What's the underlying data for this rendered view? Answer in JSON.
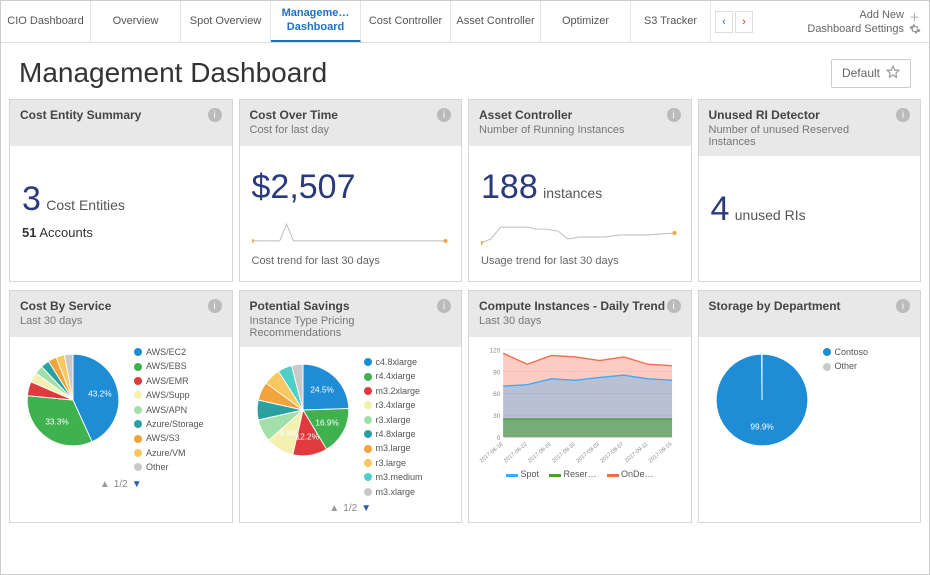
{
  "tabs": {
    "items": [
      "CIO Dashboard",
      "Overview",
      "Spot Overview",
      "Manageme… Dashboard",
      "Cost Controller",
      "Asset Controller",
      "Optimizer",
      "S3 Tracker"
    ],
    "active_index": 3
  },
  "topright": {
    "add_new": "Add New",
    "settings": "Dashboard Settings"
  },
  "header": {
    "title": "Management Dashboard",
    "default_btn": "Default"
  },
  "cards": {
    "cost_entity": {
      "title": "Cost Entity Summary",
      "big": "3",
      "big_label": "Cost Entities",
      "sub_num": "51",
      "sub_label": "Accounts"
    },
    "cost_over_time": {
      "title": "Cost Over Time",
      "subtitle": "Cost for last day",
      "big": "$2,507",
      "caption": "Cost trend for last 30 days"
    },
    "asset_controller": {
      "title": "Asset Controller",
      "subtitle": "Number of Running Instances",
      "big": "188",
      "big_label": "instances",
      "caption": "Usage trend for last 30 days"
    },
    "unused_ri": {
      "title": "Unused RI Detector",
      "subtitle": "Number of unused Reserved Instances",
      "big": "4",
      "big_label": "unused RIs"
    },
    "cost_by_service": {
      "title": "Cost By Service",
      "subtitle": "Last 30 days",
      "labels": [
        "43.2%",
        "33.3%"
      ],
      "nav": "1/2"
    },
    "potential_savings": {
      "title": "Potential Savings",
      "subtitle": "Instance Type Pricing Recommendations",
      "labels": [
        "24.5%",
        "16.9%",
        "12.2%",
        "9.9%"
      ],
      "nav": "1/2"
    },
    "compute_trend": {
      "title": "Compute Instances - Daily Trend",
      "subtitle": "Last 30 days"
    },
    "storage": {
      "title": "Storage by Department",
      "label": "99.9%"
    }
  },
  "chart_data": [
    {
      "id": "cost_trend_spark",
      "type": "line",
      "x": [
        1,
        2,
        3,
        4,
        5,
        6,
        7,
        8,
        9,
        10,
        11,
        12,
        13,
        14,
        15,
        16,
        17,
        18,
        19,
        20,
        21,
        22,
        23,
        24,
        25,
        26,
        27,
        28,
        29,
        30
      ],
      "values": [
        2300,
        2350,
        2320,
        2400,
        2380,
        5000,
        2450,
        2420,
        2400,
        2430,
        2410,
        2440,
        2460,
        2450,
        2430,
        2440,
        2420,
        2450,
        2460,
        2440,
        2450,
        2460,
        2470,
        2450,
        2440,
        2450,
        2460,
        2470,
        2480,
        2507
      ],
      "ylim": [
        2000,
        5200
      ],
      "caption": "Cost trend for last 30 days"
    },
    {
      "id": "usage_trend_spark",
      "type": "line",
      "x": [
        1,
        2,
        3,
        4,
        5,
        6,
        7,
        8,
        9,
        10,
        11,
        12,
        13,
        14,
        15,
        16,
        17,
        18,
        19,
        20,
        21,
        22,
        23,
        24,
        25,
        26,
        27,
        28,
        29,
        30
      ],
      "values": [
        140,
        150,
        200,
        205,
        210,
        205,
        195,
        200,
        198,
        190,
        195,
        192,
        190,
        165,
        170,
        168,
        172,
        170,
        175,
        172,
        174,
        176,
        175,
        174,
        176,
        178,
        176,
        180,
        182,
        188
      ],
      "ylim": [
        130,
        220
      ],
      "caption": "Usage trend for last 30 days"
    },
    {
      "id": "cost_by_service",
      "type": "pie",
      "series": [
        {
          "name": "AWS/EC2",
          "value": 43.2,
          "color": "#1f8dd6"
        },
        {
          "name": "AWS/EBS",
          "value": 33.3,
          "color": "#3fb24f"
        },
        {
          "name": "AWS/EMR",
          "value": 5.0,
          "color": "#e0393e"
        },
        {
          "name": "AWS/Supp",
          "value": 3.5,
          "color": "#f4f0b0"
        },
        {
          "name": "AWS/APN",
          "value": 3.0,
          "color": "#a3e0a8"
        },
        {
          "name": "Azure/Storage",
          "value": 3.0,
          "color": "#2aa0a0"
        },
        {
          "name": "AWS/S3",
          "value": 3.0,
          "color": "#f2a33c"
        },
        {
          "name": "Azure/VM",
          "value": 3.0,
          "color": "#f7c85f"
        },
        {
          "name": "Other",
          "value": 3.0,
          "color": "#c9c9c9"
        }
      ]
    },
    {
      "id": "potential_savings",
      "type": "pie",
      "series": [
        {
          "name": "c4.8xlarge",
          "value": 24.5,
          "color": "#1f8dd6"
        },
        {
          "name": "r4.4xlarge",
          "value": 16.9,
          "color": "#3fb24f"
        },
        {
          "name": "m3.2xlarge",
          "value": 12.2,
          "color": "#e0393e"
        },
        {
          "name": "r3.4xlarge",
          "value": 9.9,
          "color": "#f4f0b0"
        },
        {
          "name": "r3.xlarge",
          "value": 8.0,
          "color": "#a3e0a8"
        },
        {
          "name": "r4.8xlarge",
          "value": 7.0,
          "color": "#2aa0a0"
        },
        {
          "name": "m3.large",
          "value": 6.5,
          "color": "#f2a33c"
        },
        {
          "name": "r3.large",
          "value": 6.0,
          "color": "#f7c85f"
        },
        {
          "name": "m3.medium",
          "value": 5.0,
          "color": "#4fd0c7"
        },
        {
          "name": "m3.xlarge",
          "value": 4.0,
          "color": "#c9c9c9"
        }
      ]
    },
    {
      "id": "compute_daily_trend",
      "type": "area",
      "x": [
        "2017-08-18",
        "2017-08-22",
        "2017-08-26",
        "2017-08-30",
        "2017-09-03",
        "2017-09-07",
        "2017-09-11",
        "2017-09-15"
      ],
      "yticks": [
        0,
        30,
        60,
        90,
        120
      ],
      "series": [
        {
          "name": "Spot",
          "color": "#3fa9f5",
          "values": [
            70,
            72,
            80,
            78,
            82,
            85,
            80,
            78
          ]
        },
        {
          "name": "Reser…",
          "color": "#4c9f38",
          "values": [
            25,
            25,
            25,
            25,
            25,
            25,
            25,
            25
          ]
        },
        {
          "name": "OnDe…",
          "color": "#f26c4f",
          "values": [
            115,
            100,
            112,
            110,
            105,
            110,
            100,
            98
          ]
        }
      ],
      "ylim": [
        0,
        120
      ]
    },
    {
      "id": "storage_by_dept",
      "type": "pie",
      "series": [
        {
          "name": "Contoso",
          "value": 99.9,
          "color": "#1f8dd6"
        },
        {
          "name": "Other",
          "value": 0.1,
          "color": "#c9c9c9"
        }
      ]
    }
  ],
  "legends": {
    "cost_by_service": [
      "AWS/EC2",
      "AWS/EBS",
      "AWS/EMR",
      "AWS/Supp",
      "AWS/APN",
      "Azure/Storage",
      "AWS/S3",
      "Azure/VM",
      "Other"
    ],
    "cost_by_service_colors": [
      "#1f8dd6",
      "#3fb24f",
      "#e0393e",
      "#f4f0b0",
      "#a3e0a8",
      "#2aa0a0",
      "#f2a33c",
      "#f7c85f",
      "#c9c9c9"
    ],
    "potential_savings": [
      "c4.8xlarge",
      "r4.4xlarge",
      "m3.2xlarge",
      "r3.4xlarge",
      "r3.xlarge",
      "r4.8xlarge",
      "m3.large",
      "r3.large",
      "m3.medium",
      "m3.xlarge"
    ],
    "potential_savings_colors": [
      "#1f8dd6",
      "#3fb24f",
      "#e0393e",
      "#f4f0b0",
      "#a3e0a8",
      "#2aa0a0",
      "#f2a33c",
      "#f7c85f",
      "#4fd0c7",
      "#c9c9c9"
    ],
    "storage": [
      "Contoso",
      "Other"
    ],
    "storage_colors": [
      "#1f8dd6",
      "#c9c9c9"
    ],
    "compute": [
      "Spot",
      "Reser…",
      "OnDe…"
    ],
    "compute_colors": [
      "#3fa9f5",
      "#4c9f38",
      "#f26c4f"
    ]
  }
}
